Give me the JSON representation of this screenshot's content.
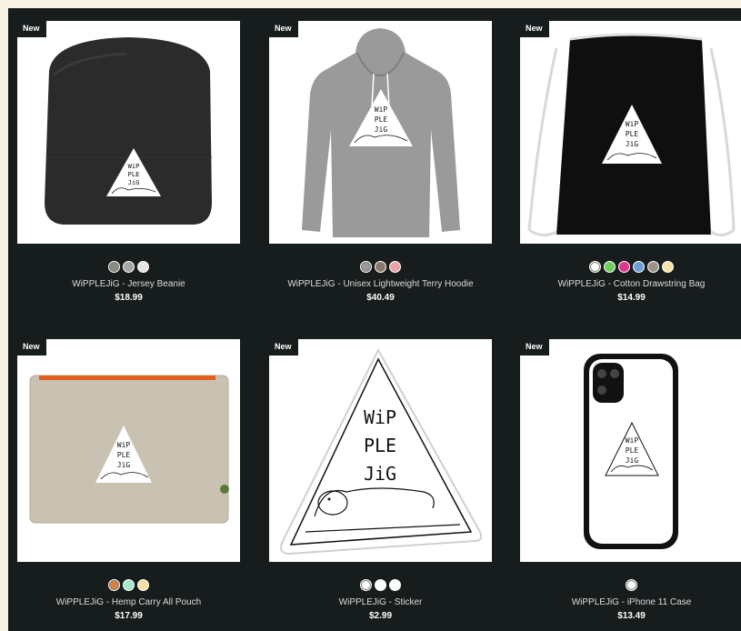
{
  "products": [
    {
      "badge": "New",
      "name": "WiPPLEJiG - Jersey Beanie",
      "price": "$18.99",
      "swatches": [
        "#8a8a80",
        "#a6a6a6",
        "#e6e6e6"
      ],
      "selected_swatch": 0,
      "image_icon": "beanie-image",
      "logo_text": [
        "WiP",
        "PLE",
        "JiG"
      ]
    },
    {
      "badge": "New",
      "name": "WiPPLEJiG - Unisex Lightweight Terry Hoodie",
      "price": "$40.49",
      "swatches": [
        "#9a9a9a",
        "#8a7a6e",
        "#e8a4a8"
      ],
      "selected_swatch": 0,
      "image_icon": "hoodie-image",
      "logo_text": [
        "WiP",
        "PLE",
        "JiG"
      ]
    },
    {
      "badge": "New",
      "name": "WiPPLEJiG - Cotton Drawstring Bag",
      "price": "$14.99",
      "swatches": [
        "#ffffff",
        "#6fcf5a",
        "#e0338a",
        "#6f9fd8",
        "#9b9486",
        "#f4e2a6"
      ],
      "selected_swatch": 0,
      "image_icon": "drawstring-bag-image",
      "logo_text": [
        "WiP",
        "PLE",
        "JiG"
      ]
    },
    {
      "badge": "New",
      "name": "WiPPLEJiG - Hemp Carry All Pouch",
      "price": "$17.99",
      "swatches": [
        "#d9813e",
        "#a8e6c9",
        "#f5dfa4"
      ],
      "selected_swatch": 0,
      "image_icon": "pouch-image",
      "logo_text": [
        "WiP",
        "PLE",
        "JiG"
      ]
    },
    {
      "badge": "New",
      "name": "WiPPLEJiG - Sticker",
      "price": "$2.99",
      "swatches": [
        "#ffffff",
        "#ffffff",
        "#ffffff"
      ],
      "selected_swatch": 0,
      "image_icon": "sticker-image",
      "logo_text": [
        "WiP",
        "PLE",
        "JiG"
      ]
    },
    {
      "badge": "New",
      "name": "WiPPLEJiG - iPhone 11 Case",
      "price": "$13.49",
      "swatches": [
        "#ffffff"
      ],
      "selected_swatch": 0,
      "image_icon": "phone-case-image",
      "logo_text": [
        "WiP",
        "PLE",
        "JiG"
      ]
    }
  ]
}
